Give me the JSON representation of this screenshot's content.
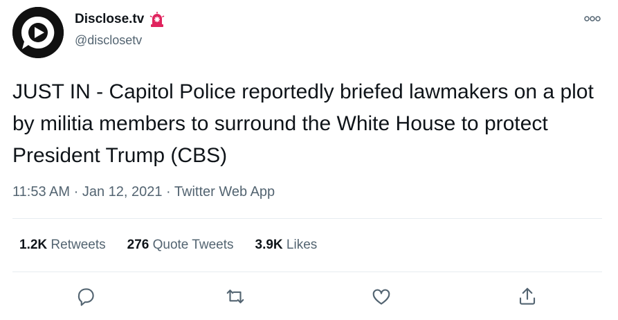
{
  "account": {
    "display_name": "Disclose.tv",
    "handle": "@disclosetv",
    "avatar_icon": "play-bubble-logo",
    "badge_icon": "siren-icon"
  },
  "tweet": {
    "text": "JUST IN - Capitol Police reportedly briefed lawmakers on a plot by militia members to surround the White House to protect President Trump (CBS)",
    "time": "11:53 AM",
    "separator": "·",
    "date": "Jan 12, 2021",
    "source": "Twitter Web App"
  },
  "stats": [
    {
      "count": "1.2K",
      "label": "Retweets"
    },
    {
      "count": "276",
      "label": "Quote Tweets"
    },
    {
      "count": "3.9K",
      "label": "Likes"
    }
  ],
  "actions": [
    "reply-icon",
    "retweet-icon",
    "like-icon",
    "share-icon"
  ],
  "colors": {
    "text": "#0f1419",
    "secondary": "#536471",
    "divider": "#e6ecf0",
    "badge": "#e0245e"
  }
}
